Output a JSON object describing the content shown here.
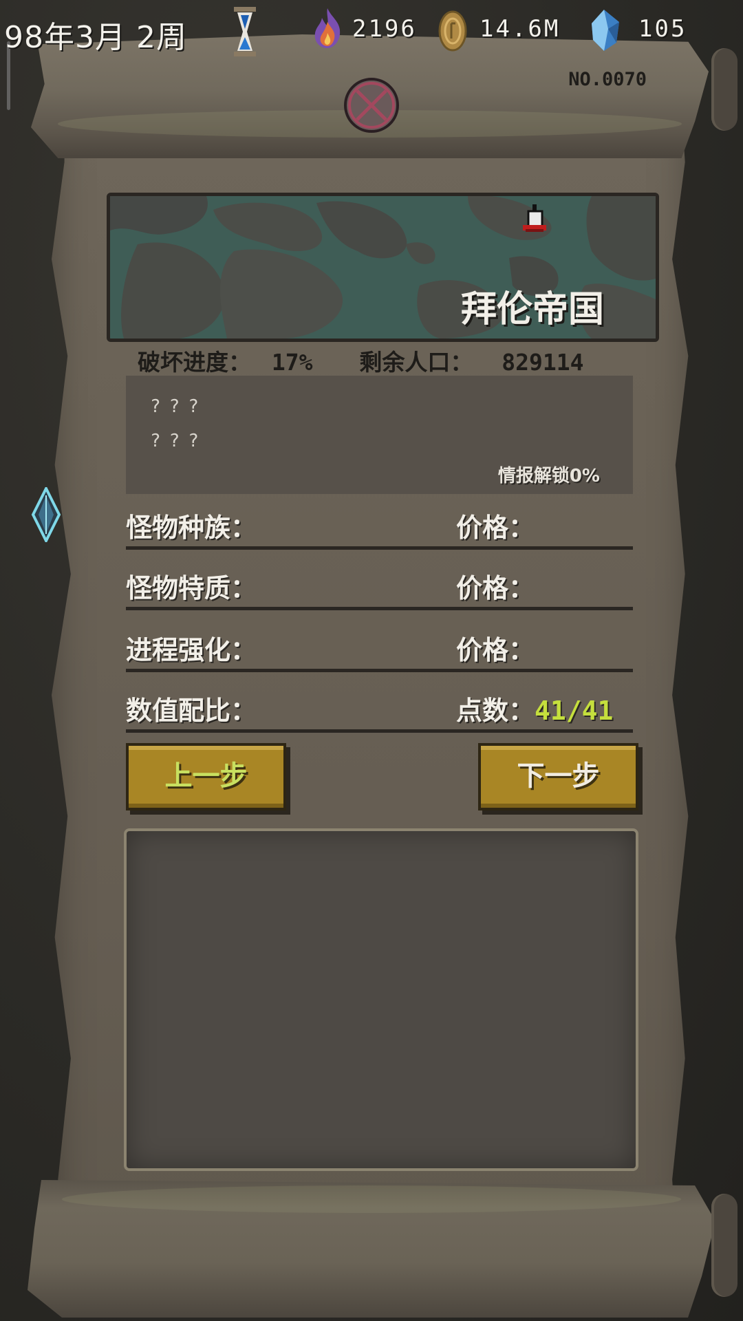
{
  "hud": {
    "date": "98年3月 2周",
    "fire_value": "2196",
    "gold_value": "14.6M",
    "crystal_value": "105"
  },
  "scroll": {
    "serial": "NO.0070"
  },
  "map": {
    "kingdom_name": "拜伦帝国"
  },
  "stats": {
    "destroy_label": "破坏进度：",
    "destroy_value": "17%",
    "population_label": "剩余人口：",
    "population_value": "829114"
  },
  "info": {
    "line1": "???",
    "line2": "???",
    "unlock_text": "情报解锁0%"
  },
  "rows": [
    {
      "left": "怪物种族：",
      "right": "价格："
    },
    {
      "left": "怪物特质：",
      "right": "价格："
    },
    {
      "left": "进程强化：",
      "right": "价格："
    },
    {
      "left": "数值配比：",
      "right": "点数：",
      "points": "41/41"
    }
  ],
  "buttons": {
    "prev": "上一步",
    "next": "下一步"
  },
  "colors": {
    "points": "#c5df3d",
    "button_gold": "#a98625",
    "parchment": "#6a6256"
  }
}
